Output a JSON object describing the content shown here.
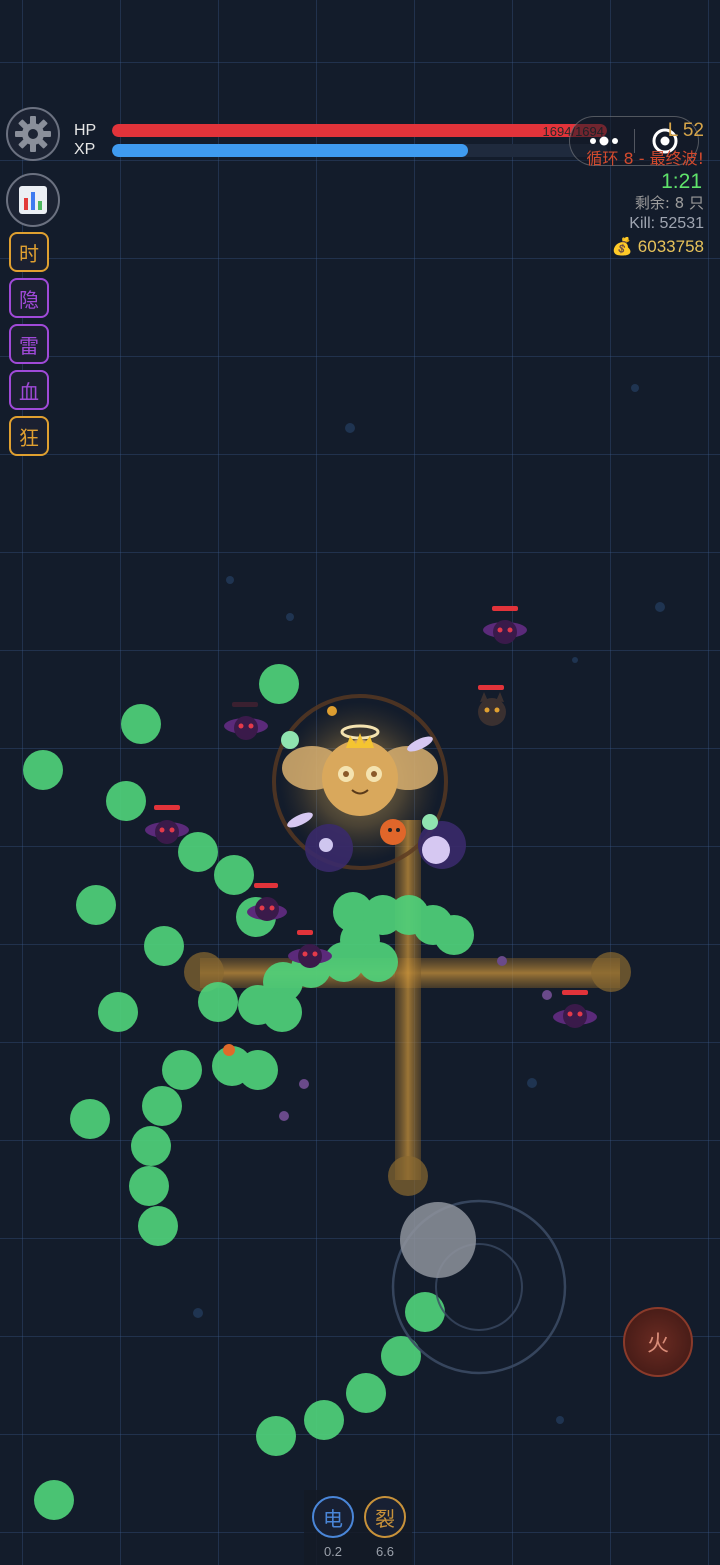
{
  "hud": {
    "hp_label": "HP",
    "xp_label": "XP",
    "hp_value": "1694/1694",
    "hp_fraction": 1.0,
    "xp_fraction": 0.72,
    "level": "L 52",
    "loop": "循环 8 - 最终波!",
    "time": "1:21",
    "remaining": "剩余: 8 只",
    "kills": "Kill: 52531",
    "gold": "💰 6033758"
  },
  "skills": [
    {
      "label": "时",
      "color": "#e0a030"
    },
    {
      "label": "隐",
      "color": "#a04ad8"
    },
    {
      "label": "雷",
      "color": "#a04ad8"
    },
    {
      "label": "血",
      "color": "#a04ad8"
    },
    {
      "label": "狂",
      "color": "#e0a030"
    }
  ],
  "abilities": [
    {
      "label": "电",
      "cooldown": "0.2",
      "color": "#4a86d8"
    },
    {
      "label": "裂",
      "cooldown": "6.6",
      "color": "#c8923a"
    }
  ],
  "fire_button": {
    "label": "火"
  },
  "icons": {
    "settings": "gear-icon",
    "stats": "bar-chart-icon",
    "menu": "more-dots-icon",
    "close": "target-close-icon"
  },
  "colors": {
    "hp": "#e2333a",
    "xp": "#3f9bf0",
    "orb": "#4fd17a",
    "enemy": "#5b2a7a",
    "beam": "#a8782a"
  }
}
